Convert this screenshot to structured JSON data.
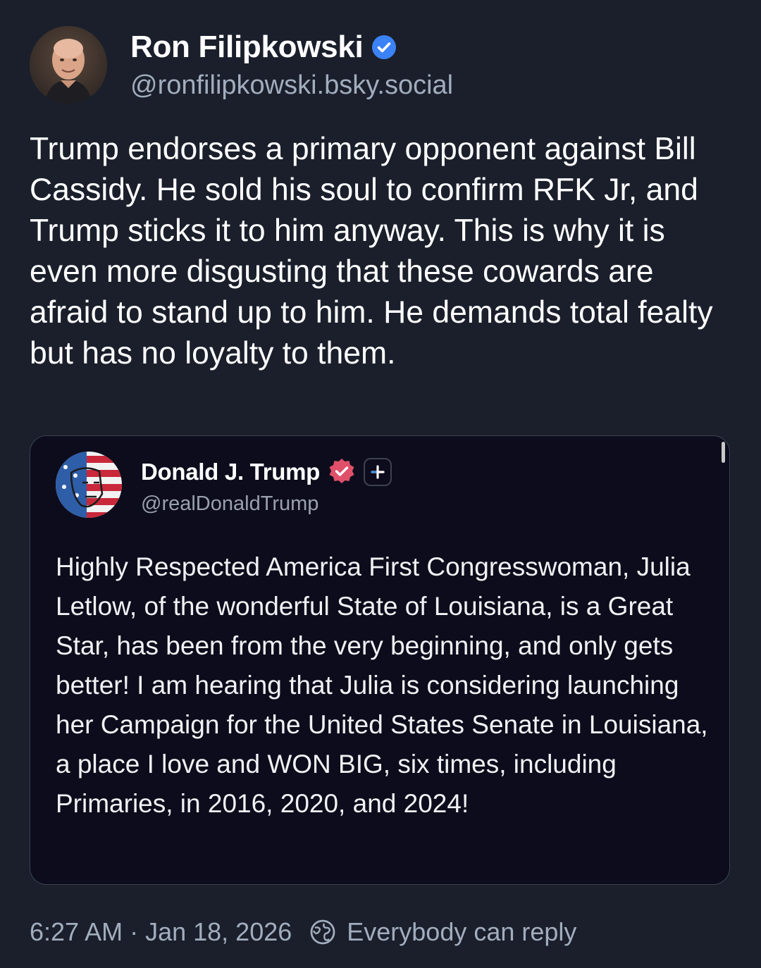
{
  "post": {
    "author": {
      "name": "Ron Filipkowski",
      "handle": "@ronfilipkowski.bsky.social",
      "verified_color": "#3b82f6"
    },
    "text": "Trump endorses a primary opponent against Bill Cassidy. He sold his soul to confirm RFK Jr, and Trump sticks it to him anyway. This is why it is even more disgusting that these cowards are afraid to stand up to him. He demands total fealty but has no loyalty to them.",
    "quote": {
      "author": {
        "name": "Donald J. Trump",
        "handle": "@realDonaldTrump",
        "verified_color": "#e0506b"
      },
      "text": "Highly Respected America First Congresswoman, Julia Letlow, of the wonderful State of Louisiana, is a Great Star, has been from the very beginning, and only gets better! I am hearing that Julia is considering launching her Campaign for the United States Senate in Louisiana, a place I love and WON BIG, six times, including Primaries, in 2016, 2020, and 2024!"
    },
    "footer": {
      "timestamp": "6:27 AM · Jan 18, 2026",
      "reply_setting": "Everybody can reply"
    }
  },
  "icons": {
    "verified": "verified-check-icon",
    "quote_verified": "verified-badge-icon",
    "quote_plus": "plus-icon",
    "reply_setting": "globe-icon"
  },
  "colors": {
    "background": "#1a1f2b",
    "quote_background": "#0c0c1c",
    "muted_text": "#a2adbd"
  }
}
